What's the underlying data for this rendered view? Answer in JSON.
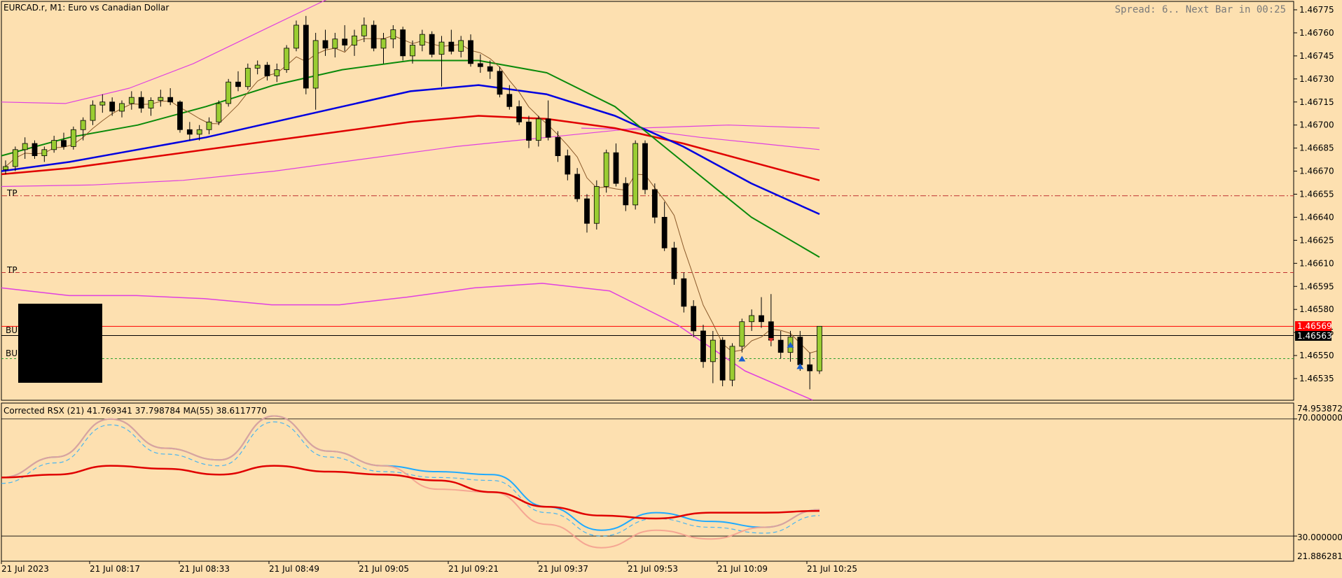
{
  "header": {
    "symbol_label": "EURCAD.r, M1:  Euro vs Canadian Dollar",
    "spread_info": "Spread: 6.. Next Bar in 00:25"
  },
  "price_pane": {
    "tp_labels": [
      "TP",
      "TP"
    ],
    "buy_labels": [
      "BU",
      "BU"
    ],
    "bid_tag": "1.46569",
    "ask_tag": "1.46563",
    "colors": {
      "ma_green": "#0a8a0a",
      "ma_blue": "#0000e0",
      "ma_red": "#e00000",
      "band": "#e040e0",
      "ma_fast": "#8b5a2b",
      "tp_line": "#c03030",
      "bid_line": "#ff0000",
      "bull": "#9acd32",
      "bear": "#000000"
    }
  },
  "indicator_pane": {
    "label": "Corrected RSX (21) 41.769341 37.798784 MA(55) 38.6117770",
    "level_high": "70.000000",
    "level_low": "30.000000",
    "scale_top": "74.953872",
    "scale_bottom": "21.886281",
    "colors": {
      "rsx": "#1eaaff",
      "rsx_dash": "#1eaaff",
      "ma": "#e00000",
      "rsx_dn": "#f4a090"
    }
  },
  "chart_data": {
    "type": "candlestick",
    "symbol": "EURCAD.r",
    "timeframe": "M1",
    "y_ticks": [
      "1.46775",
      "1.46760",
      "1.46745",
      "1.46730",
      "1.46715",
      "1.46700",
      "1.46685",
      "1.46670",
      "1.46655",
      "1.46640",
      "1.46625",
      "1.46610",
      "1.46595",
      "1.46580",
      "1.46565",
      "1.46550",
      "1.46535"
    ],
    "x_ticks": [
      "21 Jul 2023",
      "21 Jul 08:17",
      "21 Jul 08:33",
      "21 Jul 08:49",
      "21 Jul 09:05",
      "21 Jul 09:21",
      "21 Jul 09:37",
      "21 Jul 09:53",
      "21 Jul 10:09",
      "21 Jul 10:25"
    ],
    "ylim": [
      1.4652,
      1.4678
    ],
    "levels": {
      "tp1": 1.46654,
      "tp2": 1.46604,
      "bid": 1.46569,
      "ask": 1.46563,
      "buy_entry": 1.46548
    },
    "candles": [
      [
        1.46671,
        1.46677,
        1.46668,
        1.46673
      ],
      [
        1.46673,
        1.46686,
        1.4667,
        1.46684
      ],
      [
        1.46684,
        1.46692,
        1.46678,
        1.46688
      ],
      [
        1.46688,
        1.4669,
        1.46678,
        1.4668
      ],
      [
        1.4668,
        1.46686,
        1.46676,
        1.46684
      ],
      [
        1.46684,
        1.46693,
        1.46682,
        1.4669
      ],
      [
        1.4669,
        1.46695,
        1.46684,
        1.46686
      ],
      [
        1.46686,
        1.46699,
        1.46684,
        1.46697
      ],
      [
        1.46697,
        1.46705,
        1.4669,
        1.46703
      ],
      [
        1.46703,
        1.46716,
        1.467,
        1.46713
      ],
      [
        1.46713,
        1.4672,
        1.46708,
        1.46715
      ],
      [
        1.46715,
        1.46718,
        1.46706,
        1.46709
      ],
      [
        1.46709,
        1.46716,
        1.46705,
        1.46714
      ],
      [
        1.46714,
        1.46722,
        1.4671,
        1.46718
      ],
      [
        1.46718,
        1.46722,
        1.46708,
        1.46711
      ],
      [
        1.46711,
        1.46718,
        1.46706,
        1.46716
      ],
      [
        1.46716,
        1.46723,
        1.46712,
        1.46718
      ],
      [
        1.46718,
        1.46724,
        1.46713,
        1.46715
      ],
      [
        1.46715,
        1.46716,
        1.46695,
        1.46697
      ],
      [
        1.46697,
        1.46702,
        1.4669,
        1.46694
      ],
      [
        1.46694,
        1.467,
        1.4669,
        1.46697
      ],
      [
        1.46697,
        1.46705,
        1.46694,
        1.46702
      ],
      [
        1.46702,
        1.46716,
        1.467,
        1.46714
      ],
      [
        1.46714,
        1.4673,
        1.46712,
        1.46728
      ],
      [
        1.46728,
        1.46735,
        1.46722,
        1.46725
      ],
      [
        1.46725,
        1.4674,
        1.46723,
        1.46737
      ],
      [
        1.46737,
        1.46742,
        1.46733,
        1.46739
      ],
      [
        1.46739,
        1.46741,
        1.46729,
        1.46732
      ],
      [
        1.46732,
        1.4674,
        1.46728,
        1.46736
      ],
      [
        1.46736,
        1.46752,
        1.46734,
        1.4675
      ],
      [
        1.4675,
        1.46768,
        1.46748,
        1.46765
      ],
      [
        1.46765,
        1.46771,
        1.4672,
        1.46724
      ],
      [
        1.46724,
        1.4676,
        1.4671,
        1.46755
      ],
      [
        1.46755,
        1.46762,
        1.46745,
        1.4675
      ],
      [
        1.4675,
        1.4676,
        1.46744,
        1.46756
      ],
      [
        1.46756,
        1.46765,
        1.46748,
        1.46752
      ],
      [
        1.46752,
        1.46762,
        1.46745,
        1.46758
      ],
      [
        1.46758,
        1.4677,
        1.46754,
        1.46765
      ],
      [
        1.46765,
        1.46768,
        1.46748,
        1.4675
      ],
      [
        1.4675,
        1.4676,
        1.4674,
        1.46756
      ],
      [
        1.46756,
        1.46765,
        1.4675,
        1.46762
      ],
      [
        1.46762,
        1.46764,
        1.46742,
        1.46745
      ],
      [
        1.46745,
        1.46755,
        1.4674,
        1.46752
      ],
      [
        1.46752,
        1.46762,
        1.46748,
        1.46759
      ],
      [
        1.46759,
        1.46761,
        1.46744,
        1.46746
      ],
      [
        1.46746,
        1.46758,
        1.46725,
        1.46754
      ],
      [
        1.46754,
        1.46762,
        1.46746,
        1.46748
      ],
      [
        1.46748,
        1.46758,
        1.46744,
        1.46755
      ],
      [
        1.46755,
        1.46759,
        1.46738,
        1.4674
      ],
      [
        1.4674,
        1.46746,
        1.46734,
        1.46738
      ],
      [
        1.46738,
        1.46742,
        1.4673,
        1.46735
      ],
      [
        1.46735,
        1.46738,
        1.46718,
        1.4672
      ],
      [
        1.4672,
        1.46726,
        1.4671,
        1.46712
      ],
      [
        1.46712,
        1.46716,
        1.467,
        1.46702
      ],
      [
        1.46702,
        1.46706,
        1.46685,
        1.4669
      ],
      [
        1.4669,
        1.46706,
        1.46686,
        1.46704
      ],
      [
        1.46704,
        1.46716,
        1.4669,
        1.46692
      ],
      [
        1.46692,
        1.46696,
        1.46676,
        1.4668
      ],
      [
        1.4668,
        1.46684,
        1.46664,
        1.46668
      ],
      [
        1.46668,
        1.46672,
        1.4665,
        1.46652
      ],
      [
        1.46652,
        1.46655,
        1.4663,
        1.46636
      ],
      [
        1.46636,
        1.46664,
        1.46632,
        1.4666
      ],
      [
        1.4666,
        1.46684,
        1.46656,
        1.46682
      ],
      [
        1.46682,
        1.46688,
        1.4666,
        1.46662
      ],
      [
        1.46662,
        1.46666,
        1.46644,
        1.46648
      ],
      [
        1.46648,
        1.4669,
        1.46645,
        1.46688
      ],
      [
        1.46688,
        1.4669,
        1.46655,
        1.46658
      ],
      [
        1.46658,
        1.46662,
        1.46636,
        1.4664
      ],
      [
        1.4664,
        1.4665,
        1.46618,
        1.4662
      ],
      [
        1.4662,
        1.46624,
        1.46596,
        1.466
      ],
      [
        1.466,
        1.46604,
        1.46578,
        1.46582
      ],
      [
        1.46582,
        1.46586,
        1.46562,
        1.46566
      ],
      [
        1.46566,
        1.4657,
        1.46542,
        1.46546
      ],
      [
        1.46546,
        1.46566,
        1.46532,
        1.4656
      ],
      [
        1.4656,
        1.46562,
        1.4653,
        1.46534
      ],
      [
        1.46534,
        1.46558,
        1.4653,
        1.46556
      ],
      [
        1.46556,
        1.46574,
        1.46552,
        1.46572
      ],
      [
        1.46572,
        1.4658,
        1.46566,
        1.46576
      ],
      [
        1.46576,
        1.46588,
        1.46568,
        1.46572
      ],
      [
        1.46572,
        1.4659,
        1.46556,
        1.4656
      ],
      [
        1.4656,
        1.46566,
        1.46548,
        1.46552
      ],
      [
        1.46552,
        1.46566,
        1.46546,
        1.46562
      ],
      [
        1.46562,
        1.46566,
        1.4654,
        1.46544
      ],
      [
        1.46544,
        1.46552,
        1.46528,
        1.4654
      ],
      [
        1.4654,
        1.46569,
        1.46538,
        1.46569
      ]
    ],
    "ma_green": [
      1.4668,
      1.46692,
      1.467,
      1.46712,
      1.46726,
      1.46736,
      1.46742,
      1.46742,
      1.46734,
      1.46712,
      1.46676,
      1.4664,
      1.46614
    ],
    "ma_blue": [
      1.4667,
      1.46676,
      1.46684,
      1.46692,
      1.46702,
      1.46712,
      1.46722,
      1.46726,
      1.4672,
      1.46706,
      1.46686,
      1.46662,
      1.46642
    ],
    "ma_red": [
      1.46668,
      1.46672,
      1.46678,
      1.46684,
      1.4669,
      1.46696,
      1.46702,
      1.46706,
      1.46704,
      1.46698,
      1.46688,
      1.46676,
      1.46664
    ],
    "band_upper": [
      1.46715,
      1.46714,
      1.46724,
      1.4674,
      1.4676,
      1.4678,
      1.468
    ],
    "band_upper_right": [
      1.46698,
      1.46697,
      1.46692,
      1.46688,
      1.46684
    ],
    "band_lower": [
      1.4666,
      1.46661,
      1.46664,
      1.4667,
      1.46678,
      1.46686,
      1.46692,
      1.46698,
      1.467,
      1.46698
    ],
    "lower_channel": [
      1.46594,
      1.46589,
      1.46589,
      1.46587,
      1.46583,
      1.46583,
      1.46588,
      1.46594,
      1.46597,
      1.46592,
      1.4657,
      1.4654,
      1.46521
    ],
    "rsx": [
      50,
      57,
      70,
      60,
      56,
      71,
      59,
      54,
      52,
      51,
      40,
      32,
      38,
      35,
      33,
      39
    ],
    "rsx_ma": [
      50,
      51,
      54,
      53,
      51,
      54,
      52,
      51,
      49,
      45,
      40,
      37,
      36,
      38,
      38,
      38.6
    ],
    "rsx_ylim": [
      21.886281,
      74.953872
    ]
  }
}
